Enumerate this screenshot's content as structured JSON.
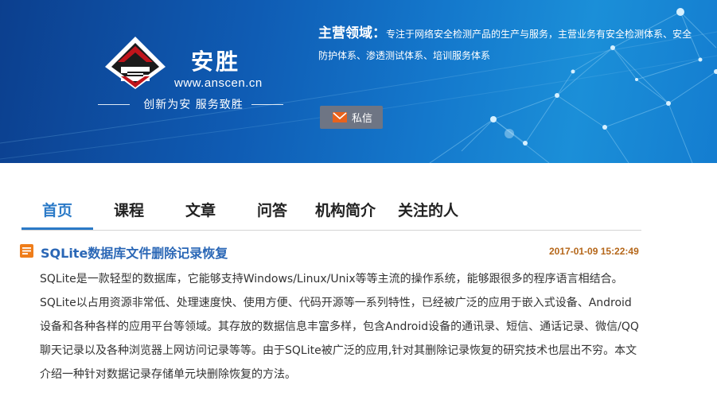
{
  "banner": {
    "brand_name": "安胜",
    "brand_url": "www.anscen.cn",
    "slogan": "创新为安  服务致胜",
    "domain_title": "主营领域：",
    "domain_text": "专注于网络安全检测产品的生产与服务，主营业务有安全检测体系、安全防护体系、渗透测试体系、培训服务体系",
    "pm_button_label": "私信",
    "colors": {
      "banner": "#1270c6",
      "button": "#6e7584",
      "logo_red": "#c0141b"
    }
  },
  "tabs": [
    {
      "label": "首页",
      "active": true
    },
    {
      "label": "课程",
      "active": false
    },
    {
      "label": "文章",
      "active": false
    },
    {
      "label": "问答",
      "active": false
    },
    {
      "label": "机构简介",
      "active": false
    },
    {
      "label": "关注的人",
      "active": false
    }
  ],
  "article": {
    "icon": "document-icon",
    "title": "SQLite数据库文件删除记录恢复",
    "date": "2017-01-09 15:22:49",
    "body": "SQLite是一款轻型的数据库，它能够支持Windows/Linux/Unix等等主流的操作系统，能够跟很多的程序语言相结合。SQLite以占用资源非常低、处理速度快、使用方便、代码开源等一系列特性，已经被广泛的应用于嵌入式设备、Android设备和各种各样的应用平台等领域。其存放的数据信息丰富多样，包含Android设备的通讯录、短信、通话记录、微信/QQ聊天记录以及各种浏览器上网访问记录等等。由于SQLite被广泛的应用,针对其删除记录恢复的研究技术也层出不穷。本文介绍一种针对数据记录存储单元块删除恢复的方法。",
    "colors": {
      "title": "#2a67b6",
      "date": "#b5671a"
    }
  }
}
